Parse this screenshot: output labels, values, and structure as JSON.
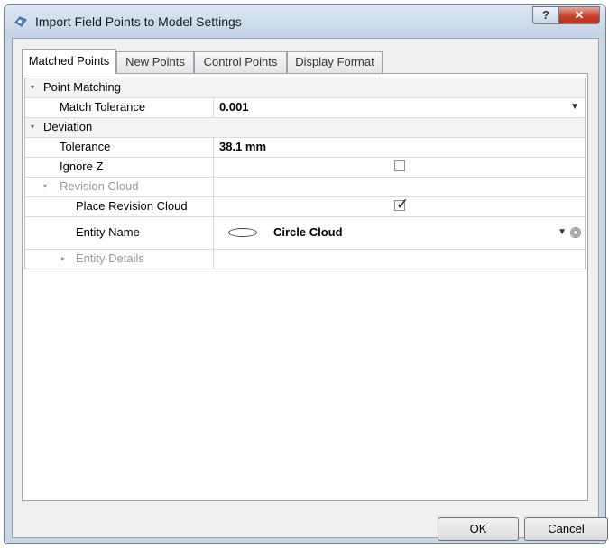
{
  "window": {
    "title": "Import Field Points to Model Settings",
    "help_label": "?",
    "close_label": "✕"
  },
  "tabs": [
    {
      "label": "Matched Points",
      "active": true
    },
    {
      "label": "New Points"
    },
    {
      "label": "Control Points"
    },
    {
      "label": "Display Format"
    }
  ],
  "grid": {
    "point_matching": {
      "label": "Point Matching",
      "expanded": true
    },
    "match_tolerance": {
      "label": "Match Tolerance",
      "value": "0.001"
    },
    "deviation": {
      "label": "Deviation",
      "expanded": true
    },
    "tolerance": {
      "label": "Tolerance",
      "value": "38.1 mm"
    },
    "ignore_z": {
      "label": "Ignore Z",
      "checked": false
    },
    "revision_cloud": {
      "label": "Revision Cloud",
      "expanded": true
    },
    "place_revision_cloud": {
      "label": "Place Revision Cloud",
      "checked": true,
      "check_glyph": "✓"
    },
    "entity_name": {
      "label": "Entity Name",
      "value": "Circle Cloud",
      "icons": [
        "ellipse-icon",
        "dropdown-arrow-icon",
        "gear-icon"
      ]
    },
    "entity_details": {
      "label": "Entity Details",
      "expanded": false
    }
  },
  "glyphs": {
    "expanded": "▾",
    "collapsed": "▸",
    "dropdown": "▼"
  },
  "buttons": {
    "ok": "OK",
    "cancel": "Cancel"
  },
  "colors": {
    "titlebar": "#c3d3e5",
    "close_button": "#c9402a",
    "disabled_text": "#999999"
  }
}
